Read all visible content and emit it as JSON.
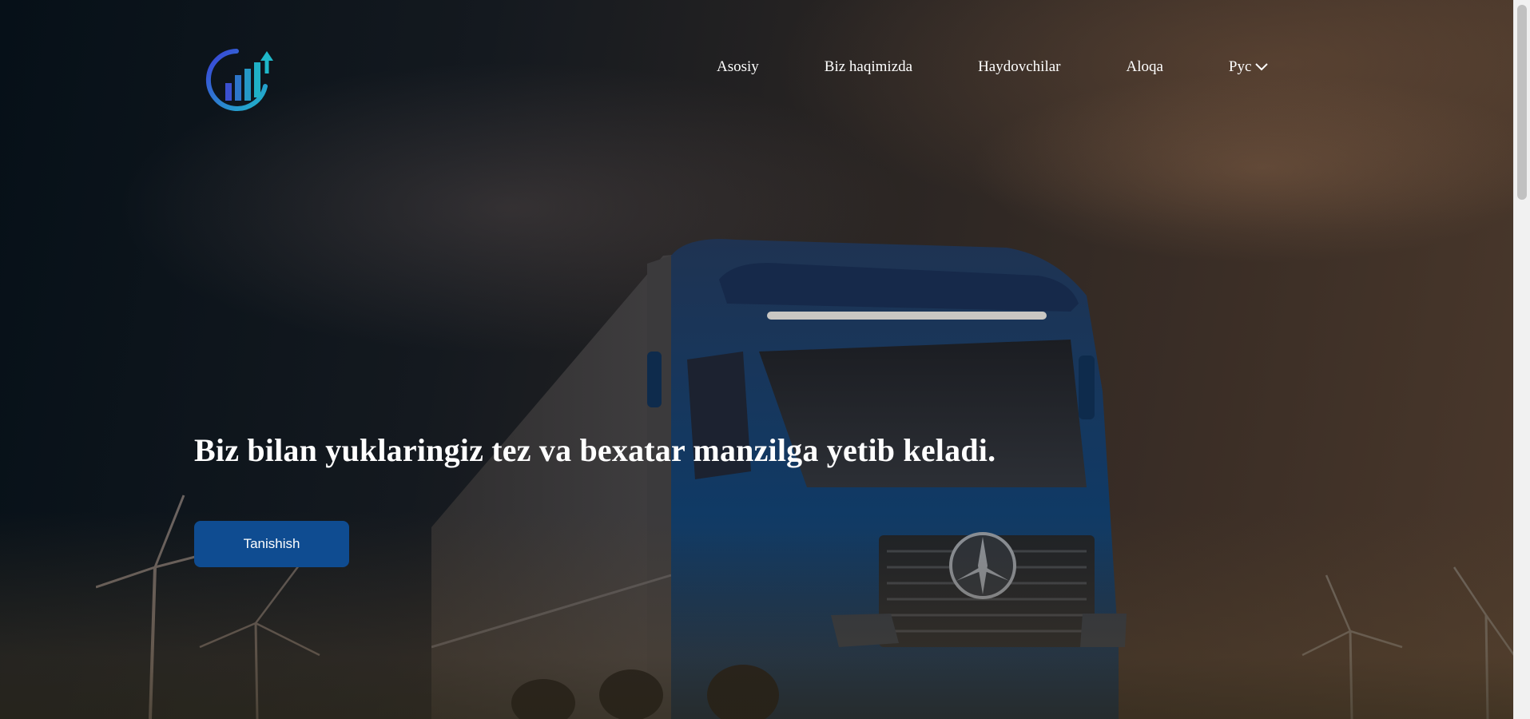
{
  "header": {
    "logo_icon": "growth-chart-logo-icon",
    "nav": {
      "items": [
        {
          "label": "Asosiy"
        },
        {
          "label": "Biz haqimizda"
        },
        {
          "label": "Haydovchilar"
        },
        {
          "label": "Aloqa"
        }
      ],
      "language": {
        "label": "Рус",
        "icon": "chevron-down-icon"
      }
    }
  },
  "hero": {
    "headline": "Biz bilan yuklaringiz tez va bexatar manzilga yetib keladi.",
    "cta_label": "Tanishish"
  },
  "colors": {
    "cta_background": "#0f4c91",
    "text": "#ffffff",
    "logo_gradient_start": "#3b3fd8",
    "logo_gradient_end": "#1fb8c9"
  }
}
